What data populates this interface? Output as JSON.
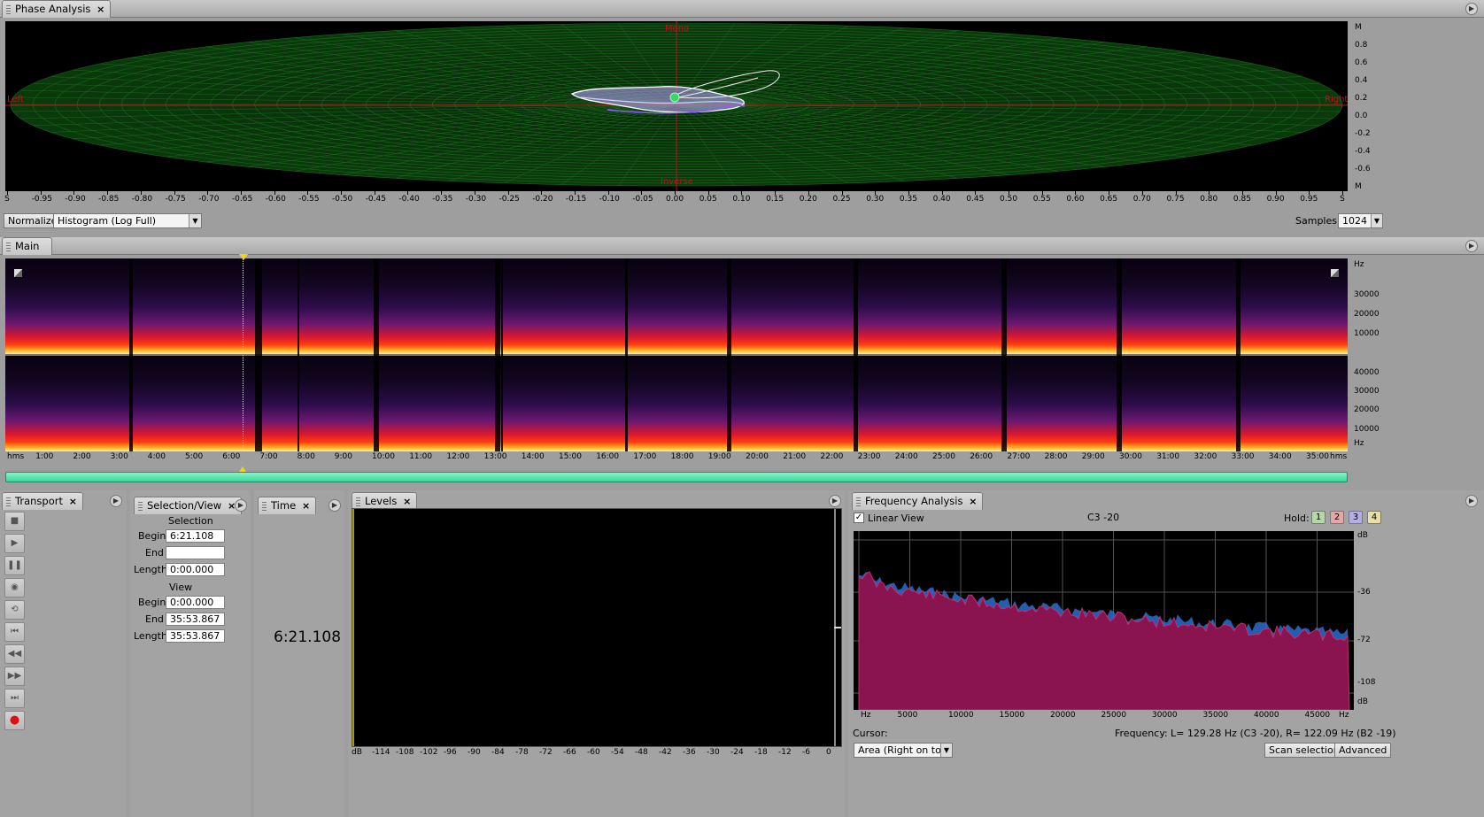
{
  "phase": {
    "tab": "Phase Analysis",
    "close": "×",
    "labels": {
      "top": "Mono",
      "bottom": "Inverse",
      "left": "Left",
      "right": "Right"
    },
    "x_ticks": [
      "S",
      "-0.95",
      "-0.90",
      "-0.85",
      "-0.80",
      "-0.75",
      "-0.70",
      "-0.65",
      "-0.60",
      "-0.55",
      "-0.50",
      "-0.45",
      "-0.40",
      "-0.35",
      "-0.30",
      "-0.25",
      "-0.20",
      "-0.15",
      "-0.10",
      "-0.05",
      "0.00",
      "0.05",
      "0.10",
      "0.15",
      "0.20",
      "0.25",
      "0.30",
      "0.35",
      "0.40",
      "0.45",
      "0.50",
      "0.55",
      "0.60",
      "0.65",
      "0.70",
      "0.75",
      "0.80",
      "0.85",
      "0.90",
      "0.95",
      "S"
    ],
    "y_ticks": [
      "M",
      "0.8",
      "0.6",
      "0.4",
      "0.2",
      "0.0",
      "-0.2",
      "-0.4",
      "-0.6",
      "M"
    ],
    "normalize_label": "Normalize",
    "mode_value": "Histogram (Log Full)",
    "samples_label": "Samples:",
    "samples_value": "1024"
  },
  "main": {
    "tab": "Main",
    "hz_top": [
      "Hz",
      "30000",
      "20000",
      "10000"
    ],
    "hz_bottom": [
      "40000",
      "30000",
      "20000",
      "10000",
      "Hz"
    ],
    "time_ticks": [
      "hms",
      "1:00",
      "2:00",
      "3:00",
      "4:00",
      "5:00",
      "6:00",
      "7:00",
      "8:00",
      "9:00",
      "10:00",
      "11:00",
      "12:00",
      "13:00",
      "14:00",
      "15:00",
      "16:00",
      "17:00",
      "18:00",
      "19:00",
      "20:00",
      "21:00",
      "22:00",
      "23:00",
      "24:00",
      "25:00",
      "26:00",
      "27:00",
      "28:00",
      "29:00",
      "30:00",
      "31:00",
      "32:00",
      "33:00",
      "34:00",
      "35:00",
      "hms"
    ]
  },
  "transport": {
    "tab": "Transport",
    "close": "×"
  },
  "selection": {
    "tab": "Selection/View",
    "close": "×",
    "selection_heading": "Selection",
    "view_heading": "View",
    "begin_label": "Begin",
    "end_label": "End",
    "length_label": "Length",
    "sel_begin": "6:21.108",
    "sel_end": "",
    "sel_length": "0:00.000",
    "view_begin": "0:00.000",
    "view_end": "35:53.867",
    "view_length": "35:53.867"
  },
  "time": {
    "tab": "Time",
    "close": "×",
    "value": "6:21.108"
  },
  "levels": {
    "tab": "Levels",
    "close": "×",
    "ticks": [
      "dB",
      "-114",
      "-108",
      "-102",
      "-96",
      "-90",
      "-84",
      "-78",
      "-72",
      "-66",
      "-60",
      "-54",
      "-48",
      "-42",
      "-36",
      "-30",
      "-24",
      "-18",
      "-12",
      "-6",
      "0"
    ]
  },
  "freq": {
    "tab": "Frequency Analysis",
    "close": "×",
    "linear_view_label": "Linear View",
    "linear_checked": "✓",
    "note": "C3 -20",
    "hold_label": "Hold:",
    "hold_buttons": [
      "1",
      "2",
      "3",
      "4"
    ],
    "db_ticks": [
      "dB",
      "-36",
      "-72",
      "-108",
      "dB"
    ],
    "x_ticks": [
      "Hz",
      "5000",
      "10000",
      "15000",
      "20000",
      "25000",
      "30000",
      "35000",
      "40000",
      "45000",
      "Hz"
    ],
    "cursor_label": "Cursor:",
    "frequency_label": "Frequency:",
    "frequency_value": "L= 129.28 Hz (C3 -20), R= 122.09 Hz (B2 -19)",
    "display_mode": "Area (Right on top)",
    "scan_button": "Scan selection",
    "advanced_button": "Advanced"
  },
  "colors": {
    "phase_grid": "#0d5a10",
    "axis_red": "#c0101a",
    "slider": "#3be0a0",
    "spec_left": "#8a1450",
    "spec_right": "#2a6fd0"
  }
}
